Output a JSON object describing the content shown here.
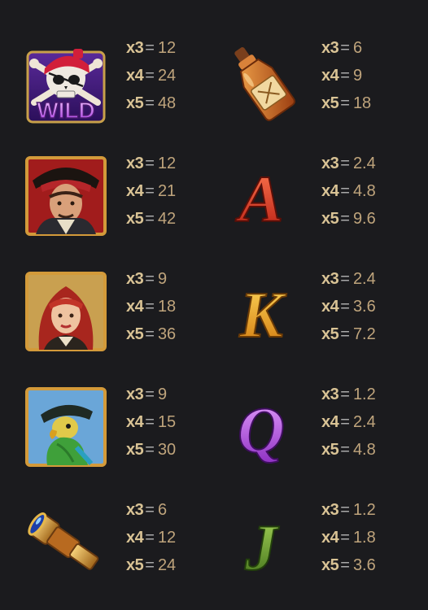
{
  "paytable": [
    {
      "symbol": "wild-skull",
      "label": "WILD",
      "pays": [
        {
          "mult": "x3",
          "value": "12"
        },
        {
          "mult": "x4",
          "value": "24"
        },
        {
          "mult": "x5",
          "value": "48"
        }
      ]
    },
    {
      "symbol": "rum-bottle",
      "pays": [
        {
          "mult": "x3",
          "value": "6"
        },
        {
          "mult": "x4",
          "value": "9"
        },
        {
          "mult": "x5",
          "value": "18"
        }
      ]
    },
    {
      "symbol": "pirate-captain",
      "pays": [
        {
          "mult": "x3",
          "value": "12"
        },
        {
          "mult": "x4",
          "value": "21"
        },
        {
          "mult": "x5",
          "value": "42"
        }
      ]
    },
    {
      "symbol": "letter-a",
      "label": "A",
      "pays": [
        {
          "mult": "x3",
          "value": "2.4"
        },
        {
          "mult": "x4",
          "value": "4.8"
        },
        {
          "mult": "x5",
          "value": "9.6"
        }
      ]
    },
    {
      "symbol": "pirate-woman",
      "pays": [
        {
          "mult": "x3",
          "value": "9"
        },
        {
          "mult": "x4",
          "value": "18"
        },
        {
          "mult": "x5",
          "value": "36"
        }
      ]
    },
    {
      "symbol": "letter-k",
      "label": "K",
      "pays": [
        {
          "mult": "x3",
          "value": "2.4"
        },
        {
          "mult": "x4",
          "value": "3.6"
        },
        {
          "mult": "x5",
          "value": "7.2"
        }
      ]
    },
    {
      "symbol": "parrot",
      "pays": [
        {
          "mult": "x3",
          "value": "9"
        },
        {
          "mult": "x4",
          "value": "15"
        },
        {
          "mult": "x5",
          "value": "30"
        }
      ]
    },
    {
      "symbol": "letter-q",
      "label": "Q",
      "pays": [
        {
          "mult": "x3",
          "value": "1.2"
        },
        {
          "mult": "x4",
          "value": "2.4"
        },
        {
          "mult": "x5",
          "value": "4.8"
        }
      ]
    },
    {
      "symbol": "spyglass",
      "pays": [
        {
          "mult": "x3",
          "value": "6"
        },
        {
          "mult": "x4",
          "value": "12"
        },
        {
          "mult": "x5",
          "value": "24"
        }
      ]
    },
    {
      "symbol": "letter-j",
      "label": "J",
      "pays": [
        {
          "mult": "x3",
          "value": "1.2"
        },
        {
          "mult": "x4",
          "value": "1.8"
        },
        {
          "mult": "x5",
          "value": "3.6"
        }
      ]
    }
  ],
  "colors": {
    "background": "#1b1b1e",
    "multiplier": "#d9c395",
    "value": "#bfa47c",
    "frame_gold": "#d39a3a",
    "letter_a": "#e2432c",
    "letter_k": "#f0a62b",
    "letter_q": "#b04fd8",
    "letter_j": "#5f9a2a"
  }
}
